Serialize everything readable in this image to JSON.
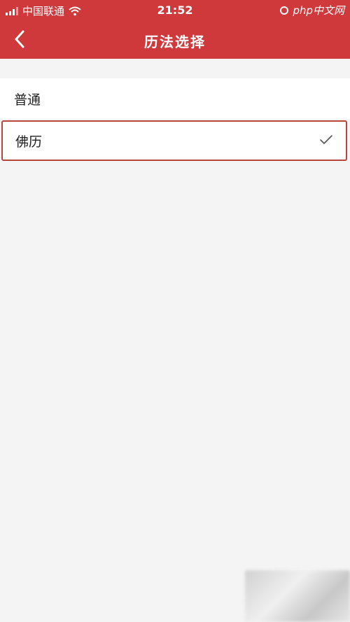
{
  "status_bar": {
    "carrier": "中国联通",
    "time": "21:52",
    "watermark": "php中文网"
  },
  "nav": {
    "title": "历法选择"
  },
  "options": [
    {
      "label": "普通",
      "selected": false
    },
    {
      "label": "佛历",
      "selected": true
    }
  ],
  "colors": {
    "header_red": "#d0393c",
    "selected_border": "#b8453a",
    "background": "#f4f4f4"
  },
  "icons": [
    "signal-icon",
    "wifi-icon",
    "back-chevron-icon",
    "checkmark-icon",
    "alarm-icon"
  ]
}
